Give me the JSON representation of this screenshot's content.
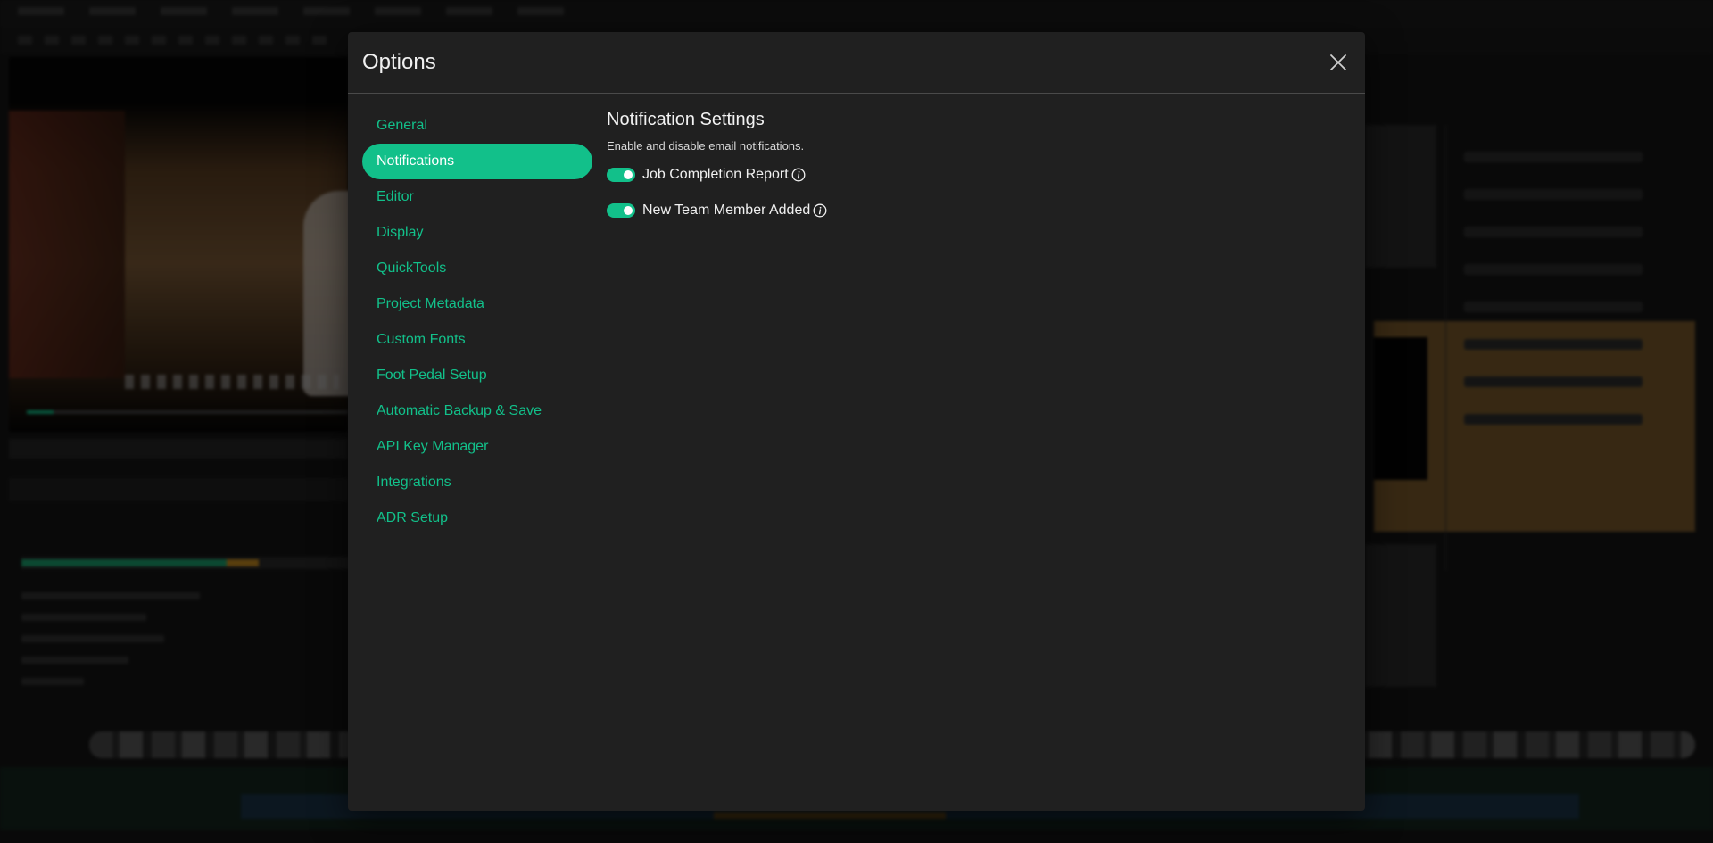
{
  "modal": {
    "title": "Options"
  },
  "nav": {
    "items": [
      {
        "label": "General"
      },
      {
        "label": "Notifications"
      },
      {
        "label": "Editor"
      },
      {
        "label": "Display"
      },
      {
        "label": "QuickTools"
      },
      {
        "label": "Project Metadata"
      },
      {
        "label": "Custom Fonts"
      },
      {
        "label": "Foot Pedal Setup"
      },
      {
        "label": "Automatic Backup & Save"
      },
      {
        "label": "API Key Manager"
      },
      {
        "label": "Integrations"
      },
      {
        "label": "ADR Setup"
      }
    ],
    "active_index": 1
  },
  "content": {
    "title": "Notification Settings",
    "description": "Enable and disable email notifications.",
    "toggles": [
      {
        "label": "Job Completion Report",
        "enabled": true,
        "icon": "info-icon"
      },
      {
        "label": "New Team Member Added",
        "enabled": true,
        "icon": "info-icon"
      }
    ]
  },
  "colors": {
    "accent": "#12c08a",
    "modal_bg": "#202020",
    "divider": "#4a4a4a"
  }
}
